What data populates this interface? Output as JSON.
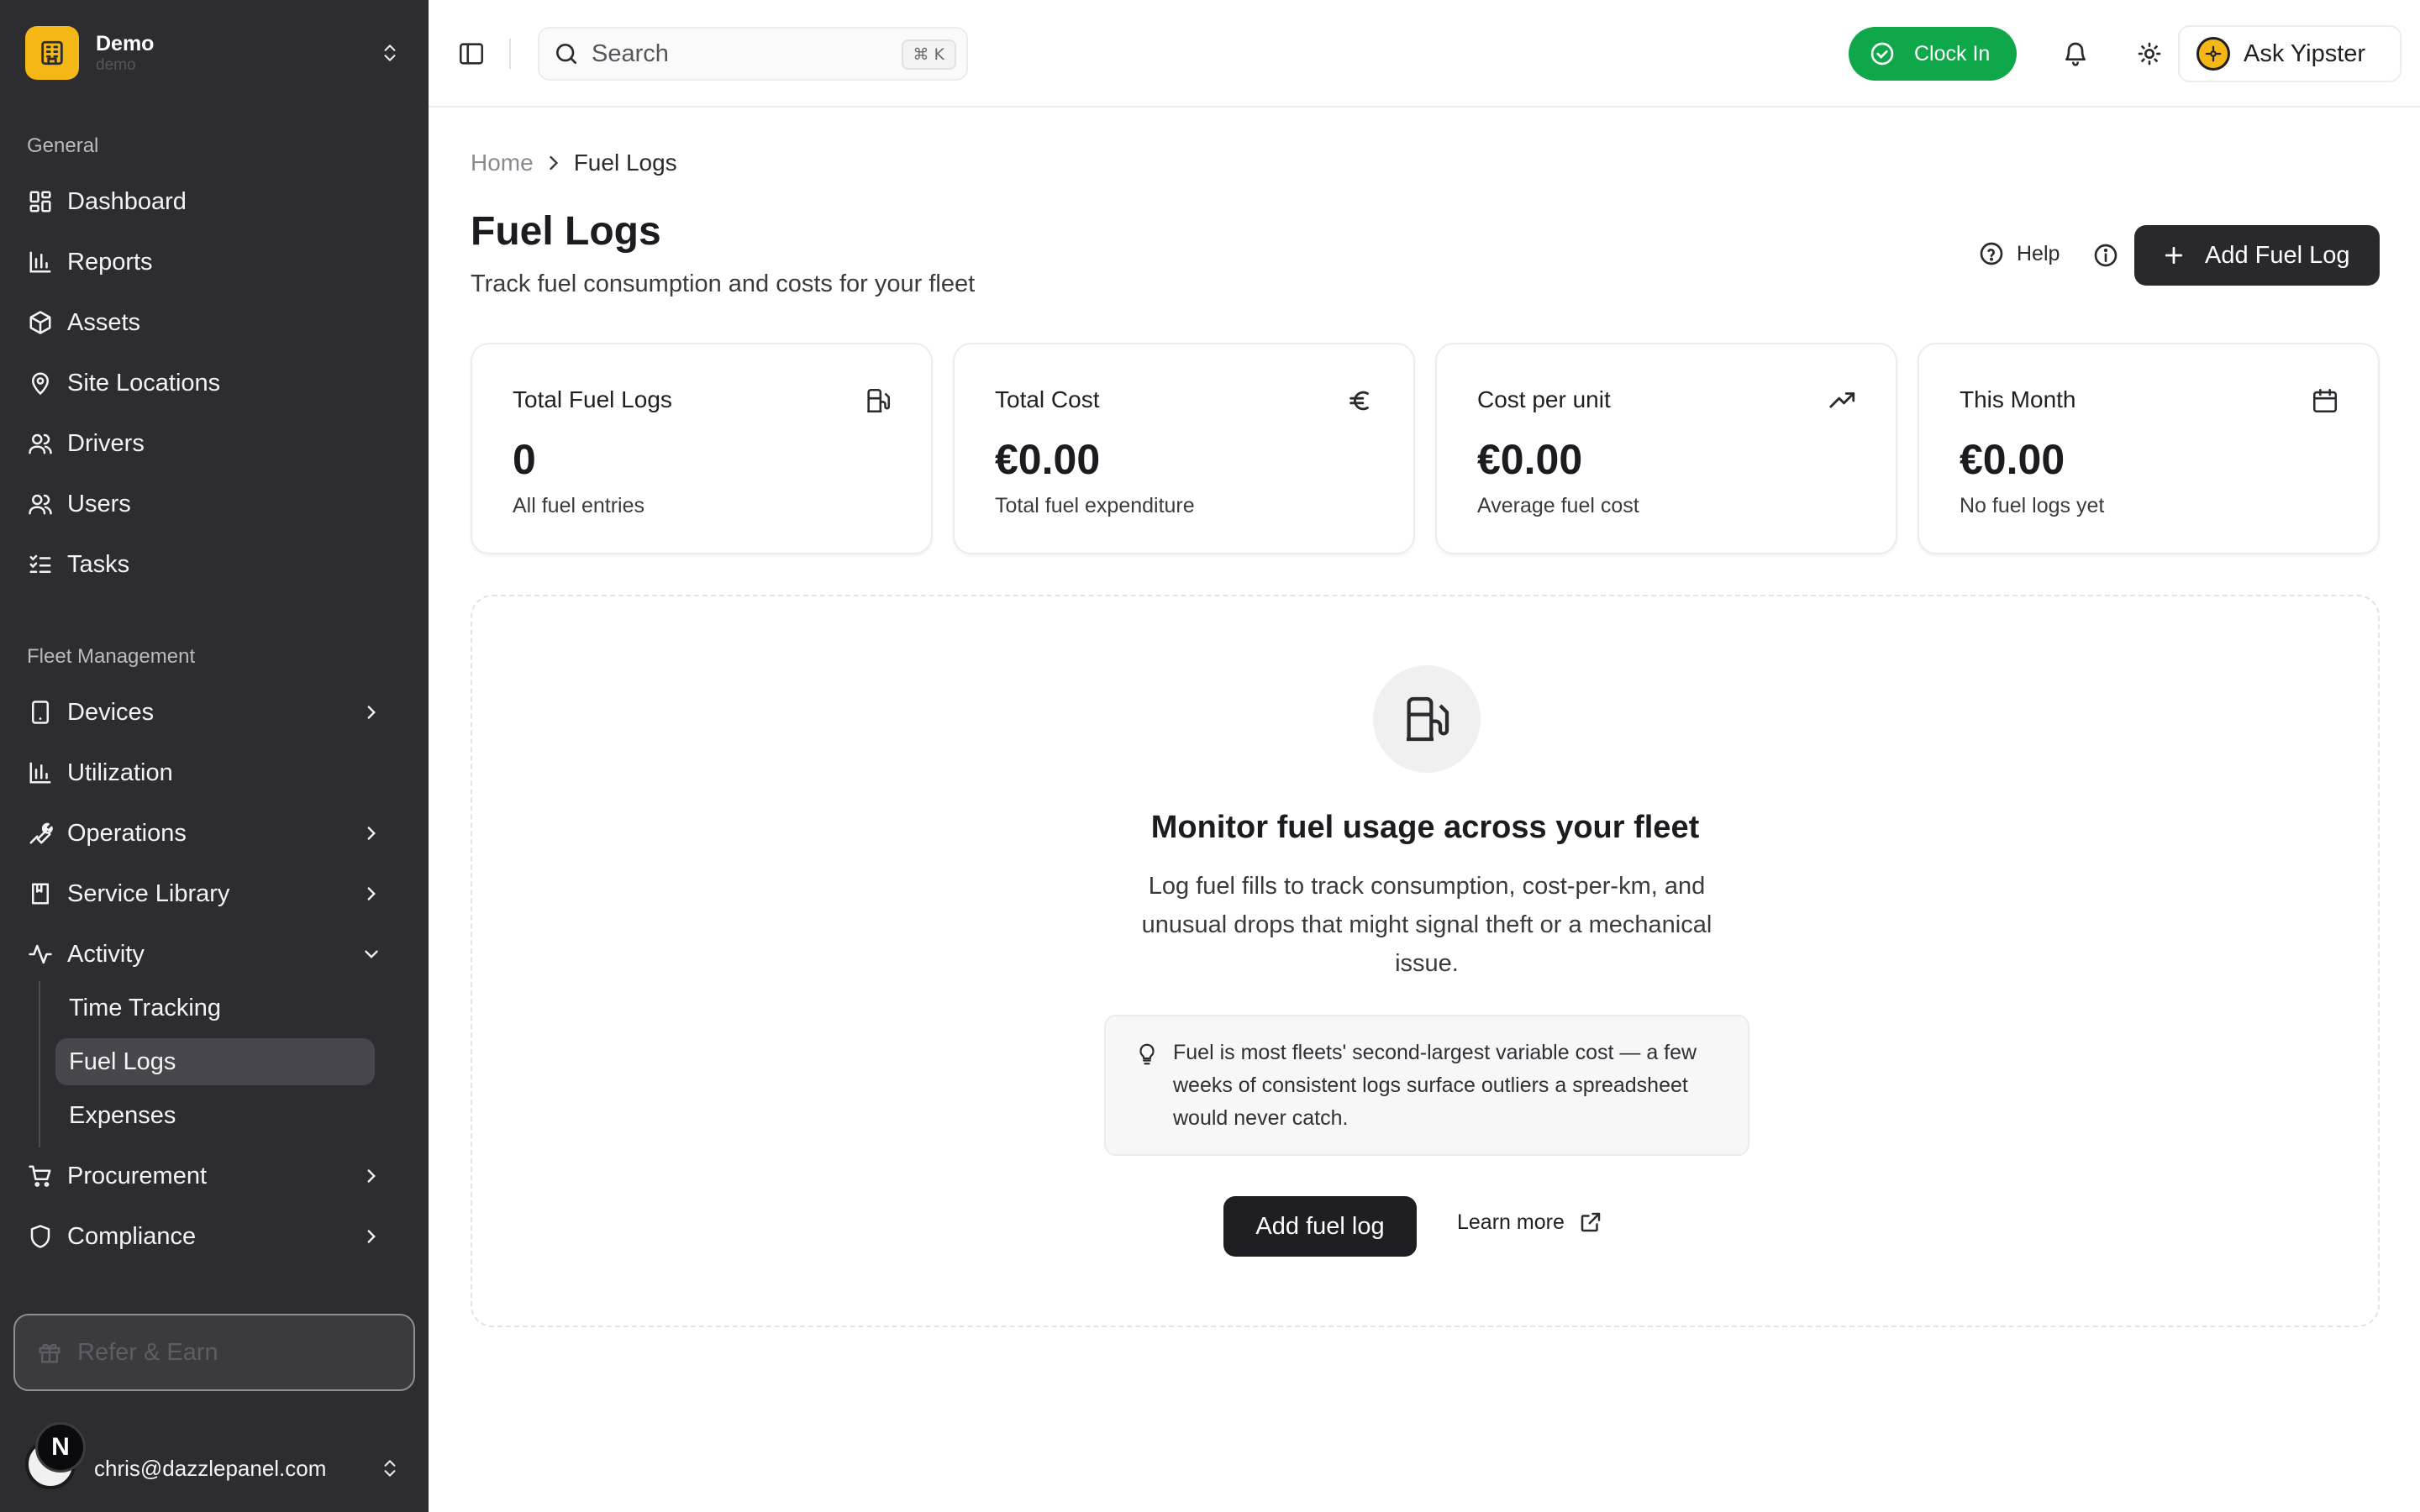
{
  "org": {
    "name": "Demo",
    "subtitle": "demo"
  },
  "sidebar": {
    "general_label": "General",
    "general_items": [
      {
        "label": "Dashboard",
        "icon": "dashboard-icon"
      },
      {
        "label": "Reports",
        "icon": "bar-chart-icon"
      },
      {
        "label": "Assets",
        "icon": "box-icon"
      },
      {
        "label": "Site Locations",
        "icon": "map-pin-icon"
      },
      {
        "label": "Drivers",
        "icon": "users-icon"
      },
      {
        "label": "Users",
        "icon": "users-icon"
      },
      {
        "label": "Tasks",
        "icon": "list-checks-icon"
      }
    ],
    "fleet_label": "Fleet Management",
    "fleet_items": [
      {
        "label": "Devices",
        "icon": "tablet-icon"
      },
      {
        "label": "Utilization",
        "icon": "bar-chart-icon"
      },
      {
        "label": "Operations",
        "icon": "wrench-icon"
      },
      {
        "label": "Service Library",
        "icon": "book-icon"
      },
      {
        "label": "Activity",
        "icon": "activity-icon"
      }
    ],
    "activity_sub": [
      "Time Tracking",
      "Fuel Logs",
      "Expenses"
    ],
    "more_items": [
      {
        "label": "Procurement",
        "icon": "cart-icon"
      },
      {
        "label": "Compliance",
        "icon": "shield-icon"
      }
    ],
    "refer_label": "Refer & Earn",
    "user_initial": "N",
    "user_email": "chris@dazzlepanel.com"
  },
  "topbar": {
    "search_placeholder": "Search",
    "search_shortcut": "⌘ K",
    "clock_in_label": "Clock In",
    "ask_label": "Ask Yipster"
  },
  "breadcrumb": {
    "home": "Home",
    "current": "Fuel Logs"
  },
  "page": {
    "title": "Fuel Logs",
    "subtitle": "Track fuel consumption and costs for your fleet",
    "help_label": "Help",
    "add_label": "Add Fuel Log"
  },
  "stats": [
    {
      "label": "Total Fuel Logs",
      "value": "0",
      "desc": "All fuel entries",
      "icon": "fuel-icon"
    },
    {
      "label": "Total Cost",
      "value": "€0.00",
      "desc": "Total fuel expenditure",
      "icon": "euro-icon"
    },
    {
      "label": "Cost per unit",
      "value": "€0.00",
      "desc": "Average fuel cost",
      "icon": "trending-up-icon"
    },
    {
      "label": "This Month",
      "value": "€0.00",
      "desc": "No fuel logs yet",
      "icon": "calendar-icon"
    }
  ],
  "empty_state": {
    "title": "Monitor fuel usage across your fleet",
    "description": "Log fuel fills to track consumption, cost-per-km, and unusual drops that might signal theft or a mechanical issue.",
    "tip": "Fuel is most fleets' second-largest variable cost — a few weeks of consistent logs surface outliers a spreadsheet would never catch.",
    "add_label": "Add fuel log",
    "learn_label": "Learn more"
  },
  "colors": {
    "accent_green": "#0ea84a",
    "brand_yellow": "#f5b716",
    "sidebar_bg": "#2c2c31"
  }
}
